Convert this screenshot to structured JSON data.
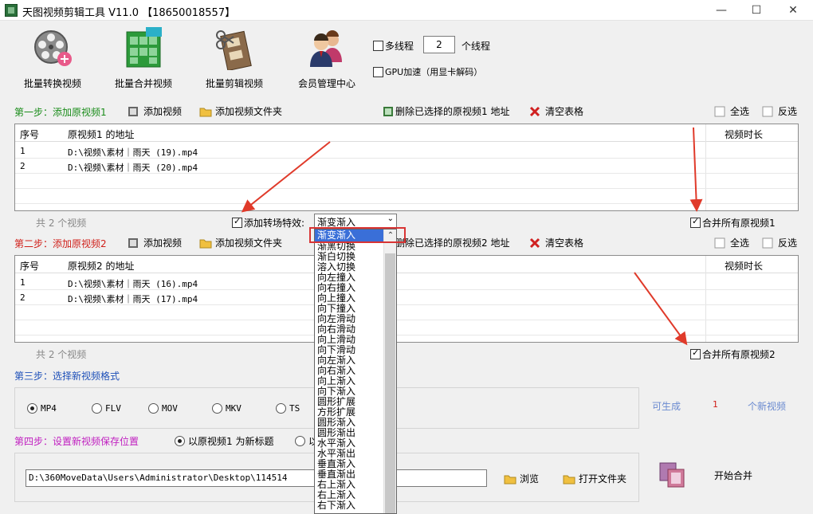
{
  "window": {
    "title": "天图视频剪辑工具 V11.0 【18650018557】",
    "minimize": "—",
    "maximize": "☐",
    "close": "✕"
  },
  "toolbar": {
    "tools": [
      {
        "label": "批量转换视频",
        "icon": "film-reel-icon"
      },
      {
        "label": "批量合并视频",
        "icon": "merge-blocks-icon"
      },
      {
        "label": "批量剪辑视频",
        "icon": "film-cut-icon"
      },
      {
        "label": "会员管理中心",
        "icon": "members-icon"
      }
    ],
    "multithread_label": "多线程",
    "thread_count": "2",
    "thread_unit": "个线程",
    "gpu_label": "GPU加速（用显卡解码）"
  },
  "step1": {
    "title_prefix": "第一步：",
    "title_main": "添加原视频1",
    "add_video": "添加视频",
    "add_folder": "添加视频文件夹",
    "delete_selected": "删除已选择的原视频1 地址",
    "clear_table": "清空表格",
    "select_all": "全选",
    "invert": "反选",
    "columns": [
      "序号",
      "原视频1 的地址",
      "视频时长"
    ],
    "rows": [
      {
        "no": "1",
        "path": "D:\\视频\\素材｜雨天 (19).mp4"
      },
      {
        "no": "2",
        "path": "D:\\视频\\素材｜雨天 (20).mp4"
      }
    ],
    "count_text": "共 2 个视频",
    "transition_label": "添加转场特效:",
    "transition_value": "渐变渐入",
    "merge_all": "合并所有原视频1"
  },
  "transition_options": [
    "渐变渐入",
    "渐黑切换",
    "渐白切换",
    "溶入切换",
    "向左撞入",
    "向右撞入",
    "向上撞入",
    "向下撞入",
    "向左滑动",
    "向右滑动",
    "向上滑动",
    "向下滑动",
    "向左渐入",
    "向右渐入",
    "向上渐入",
    "向下渐入",
    "圆形扩展",
    "方形扩展",
    "圆形渐入",
    "圆形渐出",
    "水平渐入",
    "水平渐出",
    "垂直渐入",
    "垂直渐出",
    "右上渐入",
    "右上渐入",
    "右下渐入"
  ],
  "step2": {
    "title_prefix": "第二步：",
    "title_main": "添加原视频2",
    "add_video": "添加视频",
    "add_folder": "添加视频文件夹",
    "delete_selected": "删除已选择的原视频2 地址",
    "clear_table": "清空表格",
    "select_all": "全选",
    "invert": "反选",
    "columns": [
      "序号",
      "原视频2 的地址",
      "视频时长"
    ],
    "rows": [
      {
        "no": "1",
        "path": "D:\\视频\\素材｜雨天 (16).mp4"
      },
      {
        "no": "2",
        "path": "D:\\视频\\素材｜雨天 (17).mp4"
      }
    ],
    "count_text": "共 2 个视频",
    "merge_all": "合并所有原视频2"
  },
  "step3": {
    "title": "第三步：选择新视频格式",
    "formats": [
      "MP4",
      "FLV",
      "MOV",
      "MKV",
      "TS"
    ],
    "selected_format": "MP4",
    "can_generate": "可生成",
    "generate_count": "1",
    "new_videos": "个新视频"
  },
  "step4": {
    "title": "第四步：设置新视频保存位置",
    "opt_original": "以原视频1 为新标题",
    "opt_other": "以",
    "save_path": "D:\\360MoveData\\Users\\Administrator\\Desktop\\114514",
    "browse": "浏览",
    "open_folder": "打开文件夹",
    "start_merge": "开始合并"
  },
  "colors": {
    "step_green": "#1a8c1a",
    "step_red": "#d0201a",
    "step_blue": "#1d4fb8",
    "step_magenta": "#c020c0",
    "arrow_red": "#e03a2a",
    "selection_blue": "#3a6fd8"
  }
}
